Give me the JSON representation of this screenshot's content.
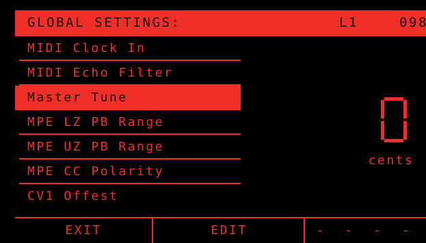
{
  "header": {
    "title": "GLOBAL SETTINGS:",
    "layer": "L1",
    "number": "098"
  },
  "menu": {
    "items": [
      {
        "label": "MIDI Clock In",
        "selected": false
      },
      {
        "label": "MIDI Echo Filter",
        "selected": false
      },
      {
        "label": "Master Tune",
        "selected": true
      },
      {
        "label": "MPE LZ PB Range",
        "selected": false
      },
      {
        "label": "MPE UZ PB Range",
        "selected": false
      },
      {
        "label": "MPE CC Polarity",
        "selected": false
      },
      {
        "label": "CV1 Offest",
        "selected": false
      }
    ]
  },
  "parameter": {
    "value": "0",
    "units": "cents"
  },
  "footer": {
    "buttons": [
      "EXIT",
      "EDIT",
      "- - - -"
    ]
  },
  "colors": {
    "accent": "#ef2f28",
    "background": "#000000",
    "text_on_accent": "#141414"
  }
}
